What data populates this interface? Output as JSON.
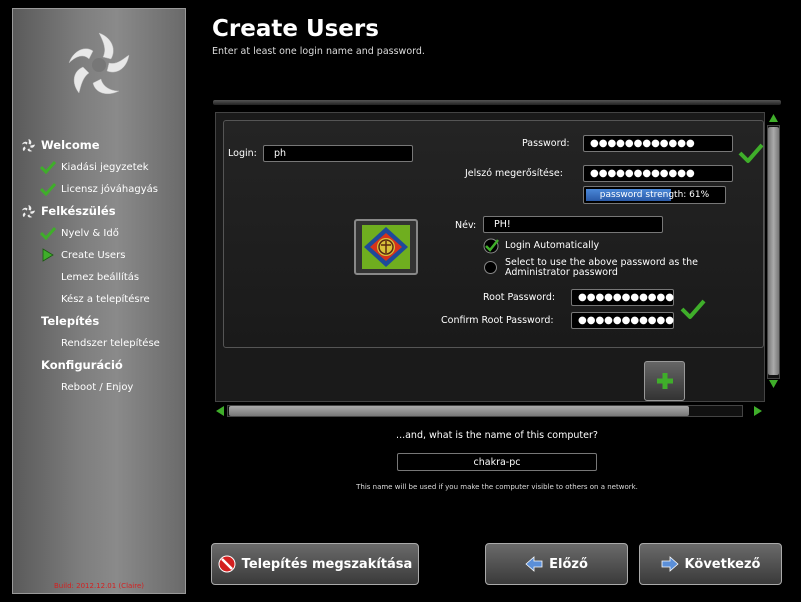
{
  "sidebar": {
    "nav": [
      {
        "label": "Welcome",
        "type": "section",
        "icon": "logo-icon"
      },
      {
        "label": "Kiadási jegyzetek",
        "type": "done"
      },
      {
        "label": "Licensz jóváhagyás",
        "type": "done"
      },
      {
        "label": "Felkészülés",
        "type": "section",
        "icon": "logo-icon"
      },
      {
        "label": "Nyelv & Idő",
        "type": "done"
      },
      {
        "label": "Create Users",
        "type": "current"
      },
      {
        "label": "Lemez beállítás",
        "type": "pending"
      },
      {
        "label": "Kész a telepítésre",
        "type": "pending"
      },
      {
        "label": "Telepítés",
        "type": "section-noicon"
      },
      {
        "label": "Rendszer telepítése",
        "type": "pending"
      },
      {
        "label": "Konfiguráció",
        "type": "section-noicon"
      },
      {
        "label": "Reboot / Enjoy",
        "type": "pending"
      }
    ],
    "build": "Build: 2012.12.01 (Claire)"
  },
  "header": {
    "title": "Create Users",
    "subtitle": "Enter at least one login name and password."
  },
  "user_form": {
    "login_label": "Login:",
    "login_value": "ph",
    "password_label": "Password:",
    "password_value": "●●●●●●●●●●●●",
    "confirm_label": "Jelszó megerősítése:",
    "confirm_value": "●●●●●●●●●●●●",
    "strength_text": "password strength: 61%",
    "strength_percent": 61,
    "name_label": "Név:",
    "name_value": "PH!",
    "autologin_label": "Login Automatically",
    "autologin_checked": true,
    "admin_pw_label": "Select to use the above password as the Administrator password",
    "admin_pw_checked": false,
    "root_pw_label": "Root Password:",
    "root_pw_value": "●●●●●●●●●●●",
    "confirm_root_label": "Confirm Root Password:",
    "confirm_root_value": "●●●●●●●●●●●"
  },
  "hostname": {
    "question": "...and, what is the name of this computer?",
    "value": "chakra-pc",
    "note": "This name will be used if you make the computer visible to others on a network."
  },
  "buttons": {
    "cancel": "Telepítés megszakítása",
    "back": "Előző",
    "next": "Következő"
  },
  "colors": {
    "check_green": "#3fae2a",
    "strength_blue": "#3a74c8",
    "build_red": "#d42020"
  }
}
